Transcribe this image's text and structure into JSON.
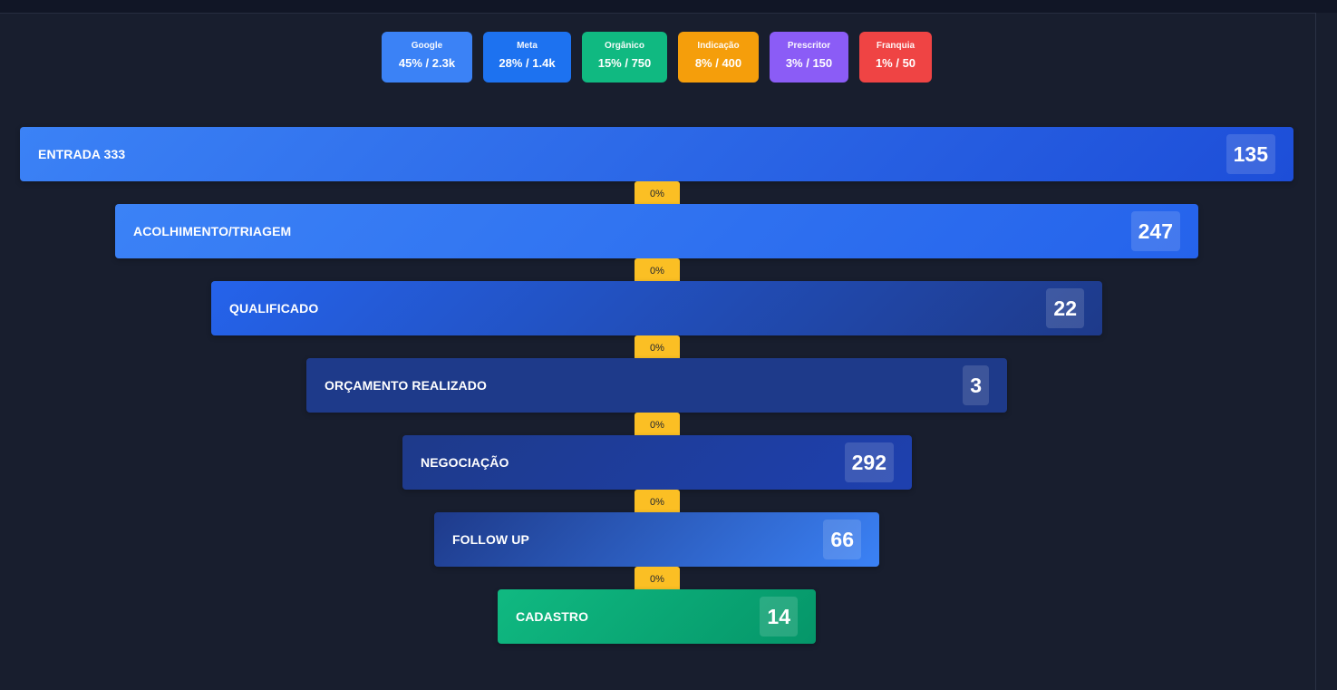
{
  "sources": [
    {
      "name": "Google",
      "value": "45% / 2.3k",
      "color": "#3b82f6"
    },
    {
      "name": "Meta",
      "value": "28% / 1.4k",
      "color": "#1d72f0"
    },
    {
      "name": "Orgânico",
      "value": "15% / 750",
      "color": "#10b981"
    },
    {
      "name": "Indicação",
      "value": "8% / 400",
      "color": "#f59e0b"
    },
    {
      "name": "Prescritor",
      "value": "3% / 150",
      "color": "#8b5cf6"
    },
    {
      "name": "Franquia",
      "value": "1% / 50",
      "color": "#ef4444"
    }
  ],
  "funnel": {
    "stages": [
      {
        "label": "ENTRADA 333",
        "count": "135",
        "gradient": [
          "#3b82f6",
          "#1d4ed8"
        ]
      },
      {
        "label": "ACOLHIMENTO/TRIAGEM",
        "count": "247",
        "gradient": [
          "#3b82f6",
          "#2563eb"
        ]
      },
      {
        "label": "QUALIFICADO",
        "count": "22",
        "gradient": [
          "#2563eb",
          "#1e3a8a"
        ]
      },
      {
        "label": "ORÇAMENTO REALIZADO",
        "count": "3",
        "gradient": [
          "#1e3a8a",
          "#1e3a8a"
        ]
      },
      {
        "label": "NEGOCIAÇÃO",
        "count": "292",
        "gradient": [
          "#1e3a8a",
          "#1e40af"
        ]
      },
      {
        "label": "FOLLOW UP",
        "count": "66",
        "gradient": [
          "#1e3a8a",
          "#3b82f6"
        ]
      },
      {
        "label": "CADASTRO",
        "count": "14",
        "gradient": [
          "#10b981",
          "#059669"
        ]
      }
    ],
    "conversions": [
      "0%",
      "0%",
      "0%",
      "0%",
      "0%",
      "0%"
    ],
    "conversion_color": "#fbbf24"
  }
}
